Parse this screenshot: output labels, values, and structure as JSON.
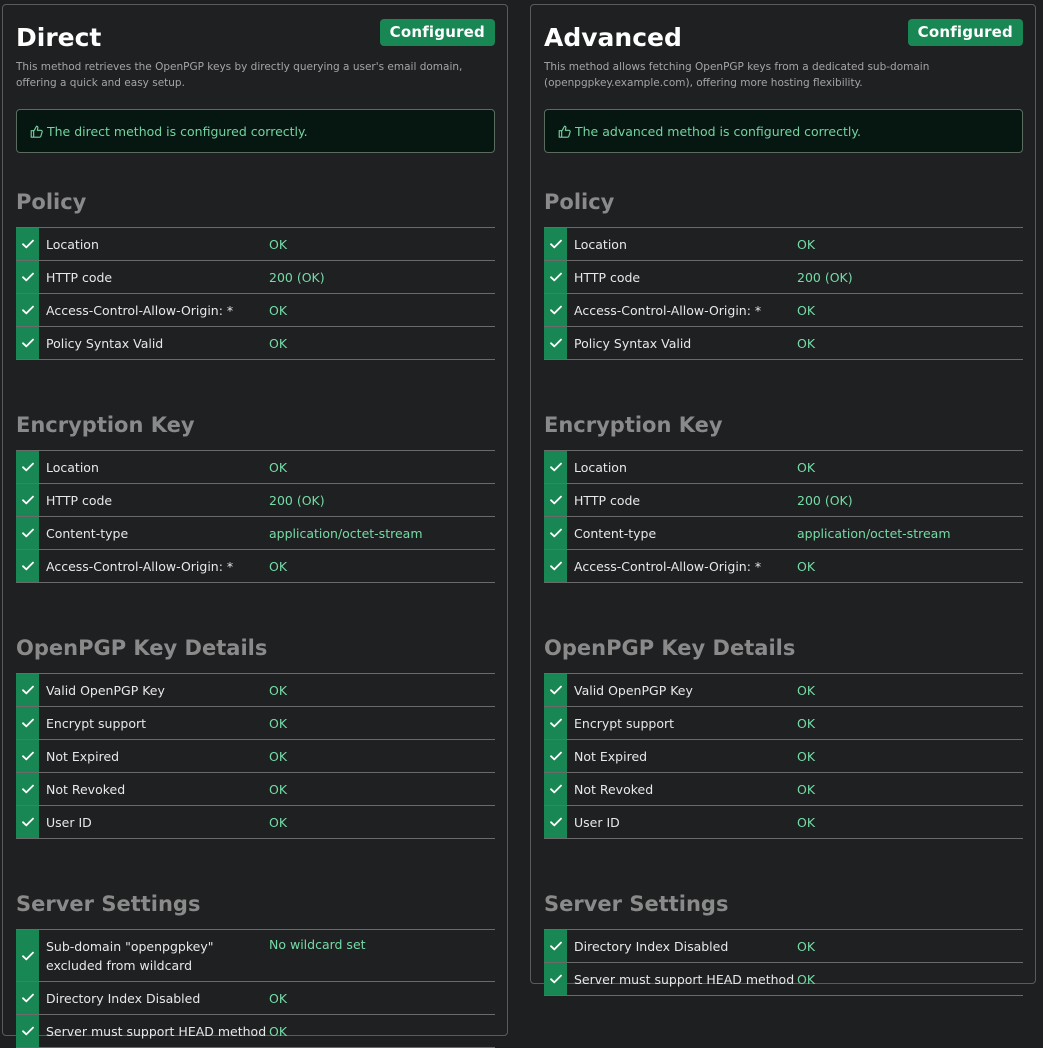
{
  "direct": {
    "title": "Direct",
    "badge": "Configured",
    "description": "This method retrieves the OpenPGP keys by directly querying a user's email domain, offering a quick and easy setup.",
    "alert": "The direct method is configured correctly.",
    "sections": {
      "policy": {
        "title": "Policy",
        "rows": [
          {
            "label": "Location",
            "value": "OK"
          },
          {
            "label": "HTTP code",
            "value": "200 (OK)"
          },
          {
            "label": "Access-Control-Allow-Origin: *",
            "value": "OK"
          },
          {
            "label": "Policy Syntax Valid",
            "value": "OK"
          }
        ]
      },
      "encryption_key": {
        "title": "Encryption Key",
        "rows": [
          {
            "label": "Location",
            "value": "OK"
          },
          {
            "label": "HTTP code",
            "value": "200 (OK)"
          },
          {
            "label": "Content-type",
            "value": "application/octet-stream"
          },
          {
            "label": "Access-Control-Allow-Origin: *",
            "value": "OK"
          }
        ]
      },
      "key_details": {
        "title": "OpenPGP Key Details",
        "rows": [
          {
            "label": "Valid OpenPGP Key",
            "value": "OK"
          },
          {
            "label": "Encrypt support",
            "value": "OK"
          },
          {
            "label": "Not Expired",
            "value": "OK"
          },
          {
            "label": "Not Revoked",
            "value": "OK"
          },
          {
            "label": "User ID",
            "value": "OK"
          }
        ]
      },
      "server_settings": {
        "title": "Server Settings",
        "rows": [
          {
            "label": "Sub-domain \"openpgpkey\" excluded from wildcard",
            "value": "No wildcard set"
          },
          {
            "label": "Directory Index Disabled",
            "value": "OK"
          },
          {
            "label": "Server must support HEAD method",
            "value": "OK"
          }
        ]
      }
    }
  },
  "advanced": {
    "title": "Advanced",
    "badge": "Configured",
    "description": "This method allows fetching OpenPGP keys from a dedicated sub-domain (openpgpkey.example.com), offering more hosting flexibility.",
    "alert": "The advanced method is configured correctly.",
    "sections": {
      "policy": {
        "title": "Policy",
        "rows": [
          {
            "label": "Location",
            "value": "OK"
          },
          {
            "label": "HTTP code",
            "value": "200 (OK)"
          },
          {
            "label": "Access-Control-Allow-Origin: *",
            "value": "OK"
          },
          {
            "label": "Policy Syntax Valid",
            "value": "OK"
          }
        ]
      },
      "encryption_key": {
        "title": "Encryption Key",
        "rows": [
          {
            "label": "Location",
            "value": "OK"
          },
          {
            "label": "HTTP code",
            "value": "200 (OK)"
          },
          {
            "label": "Content-type",
            "value": "application/octet-stream"
          },
          {
            "label": "Access-Control-Allow-Origin: *",
            "value": "OK"
          }
        ]
      },
      "key_details": {
        "title": "OpenPGP Key Details",
        "rows": [
          {
            "label": "Valid OpenPGP Key",
            "value": "OK"
          },
          {
            "label": "Encrypt support",
            "value": "OK"
          },
          {
            "label": "Not Expired",
            "value": "OK"
          },
          {
            "label": "Not Revoked",
            "value": "OK"
          },
          {
            "label": "User ID",
            "value": "OK"
          }
        ]
      },
      "server_settings": {
        "title": "Server Settings",
        "rows": [
          {
            "label": "Directory Index Disabled",
            "value": "OK"
          },
          {
            "label": "Server must support HEAD method",
            "value": "OK"
          }
        ]
      }
    }
  },
  "colors": {
    "success": "#198754",
    "ok_text": "#75dba5",
    "section_title": "#8a8a8a",
    "background": "#1e1f21"
  },
  "icons": {
    "row": "check-icon",
    "alert": "thumbs-up-icon"
  }
}
